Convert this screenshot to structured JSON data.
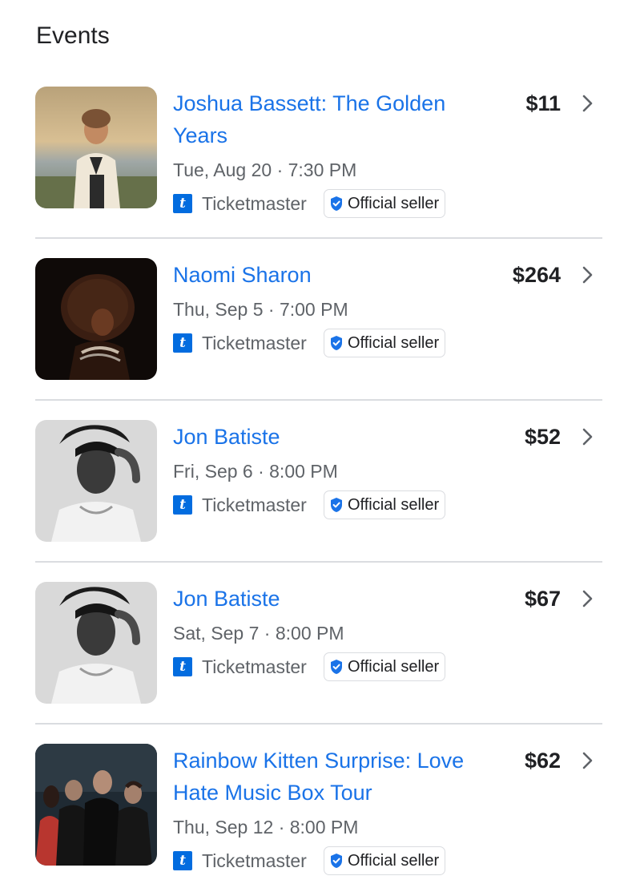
{
  "section_title": "Events",
  "colors": {
    "link": "#1a73e8",
    "secondary_text": "#5f6368",
    "ticketmaster": "#026cdf",
    "divider": "#dadce0"
  },
  "events": [
    {
      "title": "Joshua Bassett: The Golden Years",
      "price": "$11",
      "date": "Tue, Aug 20 · 7:30 PM",
      "seller": "Ticketmaster",
      "seller_logo_letter": "t",
      "badge": "Official seller",
      "image": "portrait-sunset-photo"
    },
    {
      "title": "Naomi Sharon",
      "price": "$264",
      "date": "Thu, Sep 5 · 7:00 PM",
      "seller": "Ticketmaster",
      "seller_logo_letter": "t",
      "badge": "Official seller",
      "image": "portrait-dark-photo"
    },
    {
      "title": "Jon Batiste",
      "price": "$52",
      "date": "Fri, Sep 6 · 8:00 PM",
      "seller": "Ticketmaster",
      "seller_logo_letter": "t",
      "badge": "Official seller",
      "image": "portrait-bw-photo"
    },
    {
      "title": "Jon Batiste",
      "price": "$67",
      "date": "Sat, Sep 7 · 8:00 PM",
      "seller": "Ticketmaster",
      "seller_logo_letter": "t",
      "badge": "Official seller",
      "image": "portrait-bw-photo"
    },
    {
      "title": "Rainbow Kitten Surprise: Love Hate Music Box Tour",
      "price": "$62",
      "date": "Thu, Sep 12 · 8:00 PM",
      "seller": "Ticketmaster",
      "seller_logo_letter": "t",
      "badge": "Official seller",
      "image": "band-group-photo"
    }
  ]
}
